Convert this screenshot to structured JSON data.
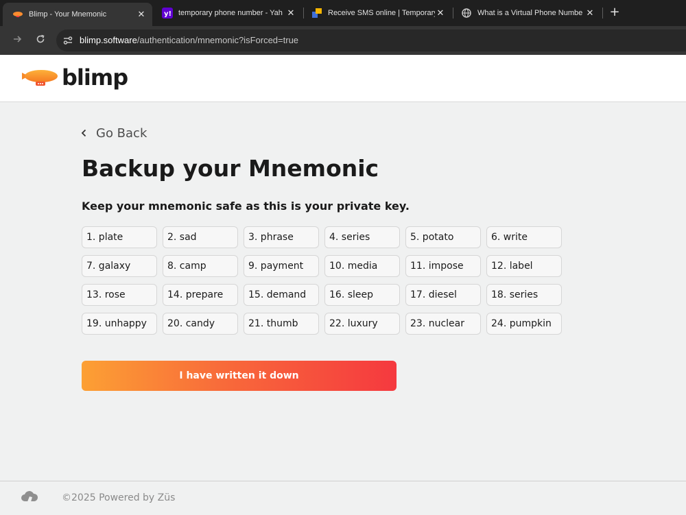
{
  "browser": {
    "tabs": [
      {
        "title": "Blimp - Your Mnemonic",
        "icon": "blimp-favicon",
        "active": true
      },
      {
        "title": "temporary phone number - Yah",
        "icon": "yahoo-favicon",
        "active": false
      },
      {
        "title": "Receive SMS online | Temporary",
        "icon": "sms-favicon",
        "active": false
      },
      {
        "title": "What is a Virtual Phone Numbe",
        "icon": "globe-favicon",
        "active": false
      }
    ],
    "close_glyph": "✕",
    "new_tab_glyph": "+",
    "url_host": "blimp.software",
    "url_path": "/authentication/mnemonic?isForced=true"
  },
  "header": {
    "logo_text": "blimp"
  },
  "main": {
    "go_back": "Go Back",
    "title": "Backup your Mnemonic",
    "subtitle": "Keep your mnemonic safe as this is your private key.",
    "words": [
      "1. plate",
      "2. sad",
      "3. phrase",
      "4. series",
      "5. potato",
      "6. write",
      "7. galaxy",
      "8. camp",
      "9. payment",
      "10. media",
      "11. impose",
      "12. label",
      "13. rose",
      "14. prepare",
      "15. demand",
      "16. sleep",
      "17. diesel",
      "18. series",
      "19. unhappy",
      "20. candy",
      "21. thumb",
      "22. luxury",
      "23. nuclear",
      "24. pumpkin"
    ],
    "confirm_button": "I have written it down"
  },
  "footer": {
    "text": "©2025 Powered by Züs"
  },
  "colors": {
    "accent_start": "#fca034",
    "accent_end": "#f5393f",
    "background": "#f0f1f1"
  }
}
